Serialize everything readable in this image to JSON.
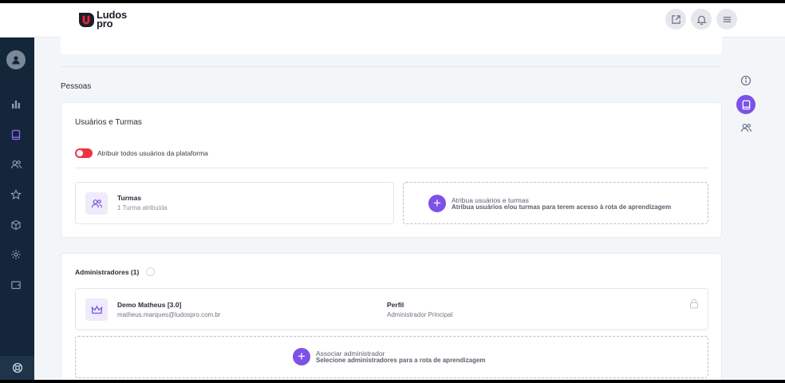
{
  "brand": {
    "line1": "Ludos",
    "line2": "pro",
    "accent": "#e0243a",
    "dark": "#1d1d2b"
  },
  "topbar": {
    "actions": [
      {
        "name": "external-link-icon"
      },
      {
        "name": "bell-icon"
      },
      {
        "name": "hamburger-menu-icon"
      }
    ]
  },
  "sidebar": {
    "items": [
      "user-avatar-icon",
      "bar-chart-icon",
      "book-icon",
      "users-icon",
      "star-icon",
      "cube-icon",
      "gear-icon",
      "wallet-icon",
      "help-lifebuoy-icon"
    ],
    "active": "book-icon",
    "active_color": "#8b63f0"
  },
  "rail": {
    "items": [
      "info-icon",
      "book-icon",
      "users-icon"
    ],
    "active": "book-icon"
  },
  "section": {
    "title": "Pessoas"
  },
  "users_card": {
    "title": "Usuários e Turmas",
    "toggle_label": "Atribuir todos usuários da plataforma",
    "toggle_on": false,
    "classes": {
      "title": "Turmas",
      "subtitle": "1 Turma atribuída"
    },
    "assign": {
      "title": "Atribua usuários e turmas",
      "subtitle": "Atribua usuários e/ou turmas para terem acesso à rota de aprendizagem"
    }
  },
  "admins_card": {
    "title": "Administradores (1)",
    "admin": {
      "name": "Demo Matheus [3.0]",
      "email": "matheus.marques@ludospro.com.br",
      "profile_label": "Perfil",
      "profile_value": "Administrador Principal"
    },
    "associate": {
      "title": "Associar administrador",
      "subtitle": "Selecione administradores para a rota de aprendizagem"
    }
  },
  "colors": {
    "primary": "#7c52e8",
    "danger": "#ef3345",
    "sidebar_bg": "#13263a"
  }
}
